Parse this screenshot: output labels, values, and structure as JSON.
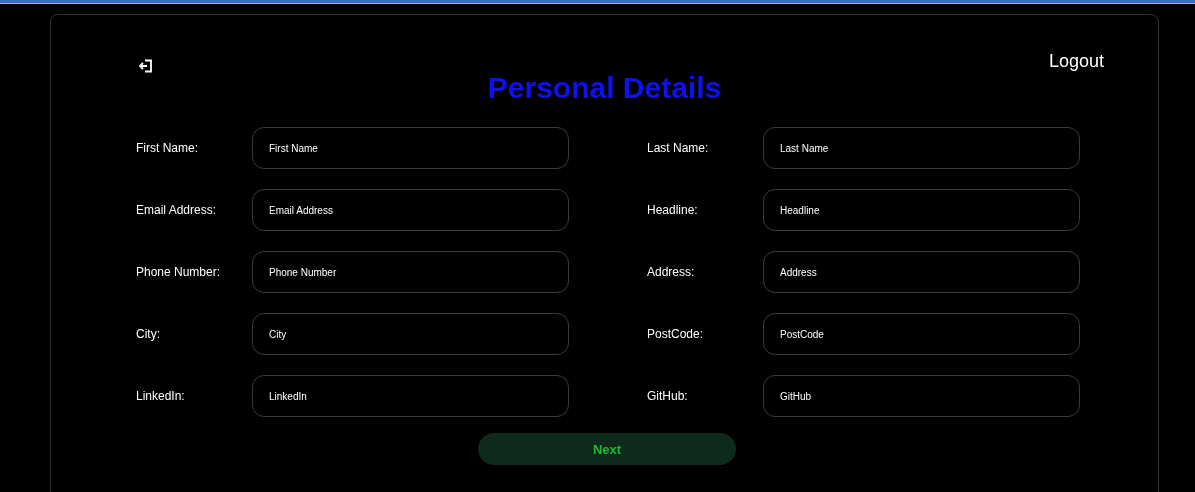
{
  "header": {
    "logout": "Logout",
    "title": "Personal Details"
  },
  "fields": [
    {
      "label": "First Name:",
      "placeholder": "First Name"
    },
    {
      "label": "Last Name:",
      "placeholder": "Last Name"
    },
    {
      "label": "Email Address:",
      "placeholder": "Email Address"
    },
    {
      "label": "Headline:",
      "placeholder": "Headline"
    },
    {
      "label": "Phone Number:",
      "placeholder": "Phone Number"
    },
    {
      "label": "Address:",
      "placeholder": "Address"
    },
    {
      "label": "City:",
      "placeholder": "City"
    },
    {
      "label": "PostCode:",
      "placeholder": "PostCode"
    },
    {
      "label": "LinkedIn:",
      "placeholder": "LinkedIn"
    },
    {
      "label": "GitHub:",
      "placeholder": "GitHub"
    }
  ],
  "next_button": "Next"
}
